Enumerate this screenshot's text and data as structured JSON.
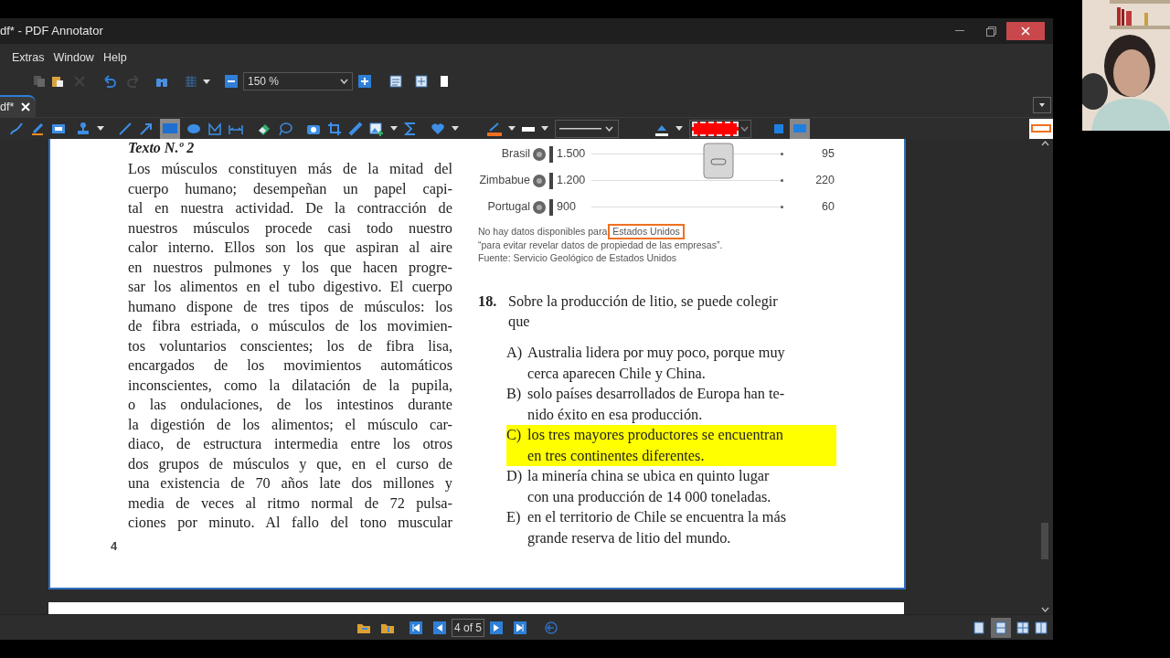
{
  "window": {
    "title": "df* - PDF Annotator"
  },
  "menu": [
    "Extras",
    "Window",
    "Help"
  ],
  "zoom": {
    "value": "150 %"
  },
  "tabs": [
    {
      "label": "df*",
      "selected": true
    }
  ],
  "chart": {
    "rows": [
      {
        "country": "Brasil",
        "production": "1.500",
        "reserve": "95"
      },
      {
        "country": "Zimbabue",
        "production": "1.200",
        "reserve": "220"
      },
      {
        "country": "Portugal",
        "production": "900",
        "reserve": "60"
      }
    ],
    "note_lead": "No hay datos disponibles para",
    "note_marked": "Estados Unidos",
    "note_quote": "“para evitar revelar datos de propiedad de las empresas”.",
    "source": "Fuente: Servicio Geológico de Estados Unidos"
  },
  "text": {
    "title": "Texto N.º 2",
    "lines": [
      "Los músculos constituyen más de la mitad del",
      "cuerpo humano; desempeñan un papel capi-",
      "tal en nuestra actividad. De la contracción de",
      "nuestros músculos procede casi todo nuestro",
      "calor interno. Ellos son los que aspiran al aire",
      "en nuestros pulmones y los que hacen progre-",
      "sar los alimentos en el tubo digestivo. El cuerpo",
      "humano dispone de tres tipos de músculos: los",
      "de fibra estriada, o músculos de los movimien-",
      "tos voluntarios conscientes; los de fibra lisa,",
      "encargados de los movimientos automáticos",
      "inconscientes, como la dilatación de la pupila,",
      "o las ondulaciones, de los intestinos durante",
      "la digestión de los alimentos; el músculo car-",
      "diaco, de estructura intermedia entre los otros",
      "dos grupos de músculos y que, en el curso de",
      "una existencia de 70 años late dos millones y",
      "media de veces al ritmo normal de 72 pulsa-",
      "ciones por minuto. Al fallo del tono muscular"
    ]
  },
  "page_number": "4",
  "question": {
    "number": "18.",
    "lines": [
      "Sobre la producción de litio, se puede colegir",
      "que"
    ],
    "options": [
      {
        "letter": "A)",
        "lines": [
          "Australia lidera por muy poco, porque muy",
          "cerca aparecen Chile y China."
        ],
        "highlighted": false
      },
      {
        "letter": "B)",
        "lines": [
          "solo países desarrollados de Europa han te-",
          "nido éxito en esa producción."
        ],
        "highlighted": false
      },
      {
        "letter": "C)",
        "lines": [
          "los tres mayores productores se encuentran",
          "en tres continentes diferentes."
        ],
        "highlighted": true
      },
      {
        "letter": "D)",
        "lines": [
          "la minería china se ubica en quinto lugar",
          "con una producción de 14 000 toneladas."
        ],
        "highlighted": false
      },
      {
        "letter": "E)",
        "lines": [
          "en el territorio de Chile se encuentra la más",
          "grande reserva de litio del mundo."
        ],
        "highlighted": false
      }
    ]
  },
  "status_bar": {
    "page": "4 of 5"
  }
}
